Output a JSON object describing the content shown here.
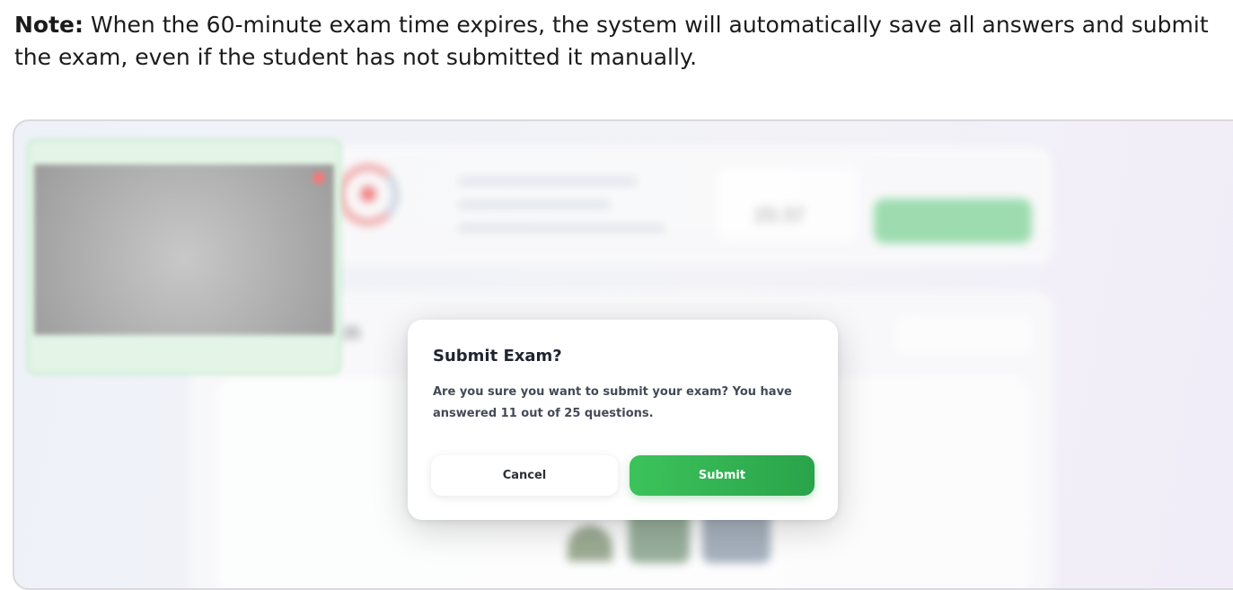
{
  "note": {
    "label": "Note:",
    "text": " When the 60-minute exam time expires, the system will automatically save all answers and submit the exam, even if the student has not submitted it manually."
  },
  "background": {
    "timer_value": "25:37",
    "question_counter": "/ 25",
    "colors": {
      "accent_green": "#2aa34a",
      "accent_red": "#ef6b6b"
    }
  },
  "modal": {
    "title": "Submit Exam?",
    "message": "Are you sure you want to submit your exam? You have answered 11 out of 25 questions.",
    "cancel_label": "Cancel",
    "submit_label": "Submit"
  },
  "icons": [
    "camera-feed-close-icon",
    "app-logo-icon"
  ]
}
